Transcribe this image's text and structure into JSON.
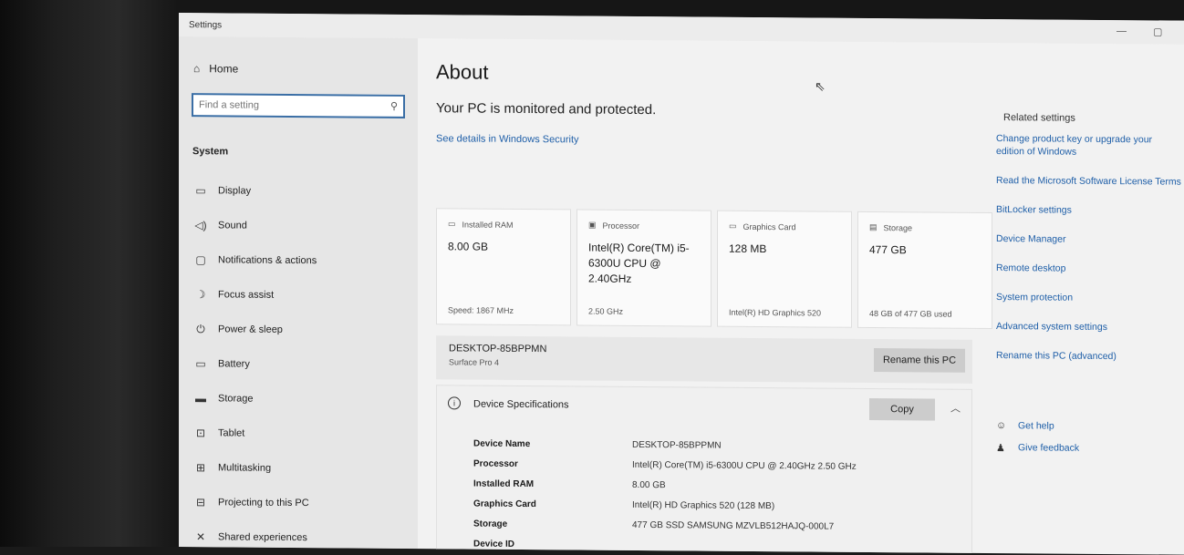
{
  "window": {
    "title": "Settings",
    "minimize": "—",
    "maximize": "▢"
  },
  "sidebar": {
    "home": "Home",
    "search_placeholder": "Find a setting",
    "section": "System",
    "items": [
      {
        "label": "Display",
        "icon": "▭"
      },
      {
        "label": "Sound",
        "icon": "◁)"
      },
      {
        "label": "Notifications & actions",
        "icon": "▢"
      },
      {
        "label": "Focus assist",
        "icon": "☽"
      },
      {
        "label": "Power & sleep",
        "icon": "⏻"
      },
      {
        "label": "Battery",
        "icon": "▭"
      },
      {
        "label": "Storage",
        "icon": "▬"
      },
      {
        "label": "Tablet",
        "icon": "⊡"
      },
      {
        "label": "Multitasking",
        "icon": "⊞"
      },
      {
        "label": "Projecting to this PC",
        "icon": "⊟"
      },
      {
        "label": "Shared experiences",
        "icon": "✕"
      }
    ]
  },
  "main": {
    "title": "About",
    "monitored": "Your PC is monitored and protected.",
    "security_link": "See details in Windows Security",
    "cards": [
      {
        "head": "Installed RAM",
        "icon": "▭",
        "value": "8.00 GB",
        "foot": "Speed: 1867 MHz"
      },
      {
        "head": "Processor",
        "icon": "▣",
        "value": "Intel(R) Core(TM) i5-6300U CPU @ 2.40GHz",
        "foot": "2.50 GHz"
      },
      {
        "head": "Graphics Card",
        "icon": "▭",
        "value": "128 MB",
        "foot": "Intel(R) HD Graphics 520"
      },
      {
        "head": "Storage",
        "icon": "▤",
        "value": "477 GB",
        "foot": "48 GB of 477 GB used"
      }
    ],
    "pc_name": "DESKTOP-85BPPMN",
    "pc_model": "Surface Pro 4",
    "rename_label": "Rename this PC",
    "specs": {
      "title": "Device Specifications",
      "copy_label": "Copy",
      "rows": [
        {
          "k": "Device Name",
          "v": "DESKTOP-85BPPMN"
        },
        {
          "k": "Processor",
          "v": "Intel(R) Core(TM) i5-6300U CPU @ 2.40GHz   2.50 GHz"
        },
        {
          "k": "Installed RAM",
          "v": "8.00 GB"
        },
        {
          "k": "Graphics Card",
          "v": "Intel(R) HD Graphics 520 (128 MB)"
        },
        {
          "k": "Storage",
          "v": "477 GB SSD SAMSUNG MZVLB512HAJQ-000L7"
        },
        {
          "k": "Device ID",
          "v": ""
        }
      ]
    }
  },
  "related": {
    "heading": "Related settings",
    "links": [
      "Change product key or upgrade your edition of Windows",
      "Read the Microsoft Software License Terms",
      "BitLocker settings",
      "Device Manager",
      "Remote desktop",
      "System protection",
      "Advanced system settings",
      "Rename this PC (advanced)"
    ],
    "get_help": "Get help",
    "give_feedback": "Give feedback"
  }
}
